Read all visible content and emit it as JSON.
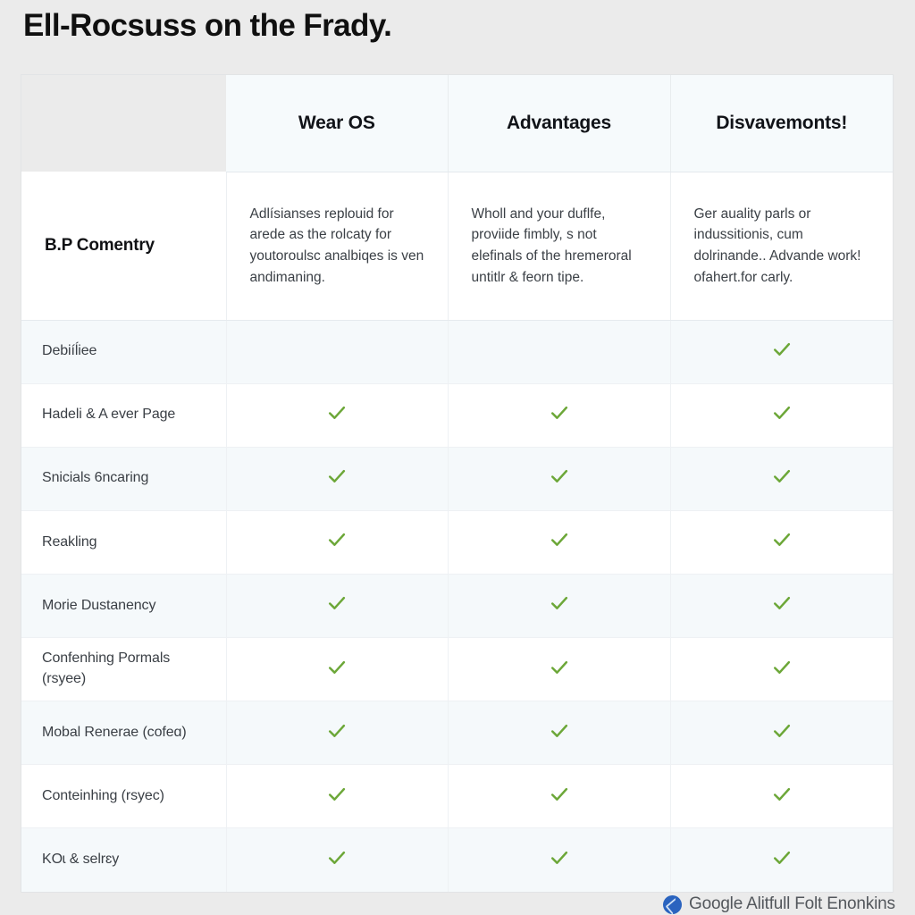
{
  "page": {
    "title": "Ell-Rocsuss on the Frady.",
    "background_color": "#ebebeb",
    "check_color": "#6ca738",
    "header_bg_color": "#f6fafc",
    "alt_row_color": "#f5f9fb"
  },
  "table": {
    "columns": [
      {
        "key": "label",
        "label": ""
      },
      {
        "key": "wearos",
        "label": "Wear OS"
      },
      {
        "key": "advantages",
        "label": "Advantages"
      },
      {
        "key": "disadvantages",
        "label": "Disvavemonts!"
      }
    ],
    "intro_row": {
      "label": "B.P Comentry",
      "wearos": "Adlísianses replouid for arede as the rolcaty for youtoroulsc analbiqes is ven andimaning.",
      "advantages": "Wholl and your duflfe, proviide fimbly, s not elefinals of the hremeroral untitlr & feorn tipe.",
      "disadvantages": "Ger auality parls or indussitionis, cum dolrinande.. Advande work! ofahert.for carly."
    },
    "rows": [
      {
        "label": "Debiíĺiee",
        "wearos": false,
        "advantages": false,
        "disadvantages": true
      },
      {
        "label": "Hadeli & A ever Page",
        "wearos": true,
        "advantages": true,
        "disadvantages": true
      },
      {
        "label": "Snicials 6ncaring",
        "wearos": true,
        "advantages": true,
        "disadvantages": true
      },
      {
        "label": "Reakling",
        "wearos": true,
        "advantages": true,
        "disadvantages": true
      },
      {
        "label": "Morie Dustanency",
        "wearos": true,
        "advantages": true,
        "disadvantages": true
      },
      {
        "label": "Confenhing Pormals (rsyee)",
        "wearos": true,
        "advantages": true,
        "disadvantages": true
      },
      {
        "label": "Mobal Renerae (cofeɑ)",
        "wearos": true,
        "advantages": true,
        "disadvantages": true
      },
      {
        "label": "Conteinhing (rsyec)",
        "wearos": true,
        "advantages": true,
        "disadvantages": true
      },
      {
        "label": "KOɩ & selrɛy",
        "wearos": true,
        "advantages": true,
        "disadvantages": true
      }
    ]
  },
  "watermark": {
    "text": "Google Alitfull Folt Enonkins",
    "icon": "google-badge-icon",
    "icon_color": "#2a63bf"
  }
}
